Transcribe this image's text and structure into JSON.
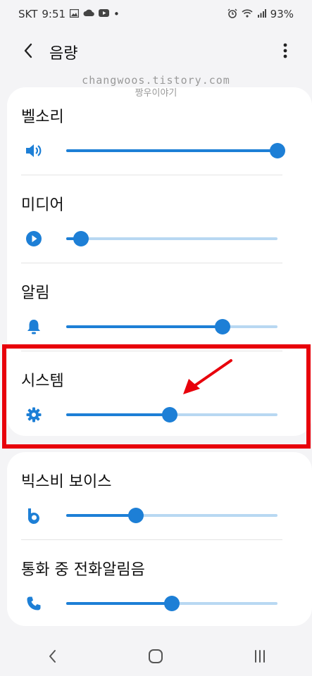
{
  "status_bar": {
    "carrier": "SKT",
    "time": "9:51",
    "dot": "•",
    "battery": "93%",
    "left_icons": [
      "image-icon",
      "cloud-icon",
      "youtube-icon"
    ],
    "right_icons": [
      "alarm-icon",
      "wifi-icon",
      "signal-icon"
    ]
  },
  "header": {
    "title": "음량"
  },
  "watermark": {
    "line1": "changwoos.tistory.com",
    "line2": "짱우이야기"
  },
  "volume_rows": [
    {
      "label": "벨소리",
      "icon": "speaker-icon",
      "level": 1.0
    },
    {
      "label": "미디어",
      "icon": "play-icon",
      "level": 0.07
    },
    {
      "label": "알림",
      "icon": "bell-icon",
      "level": 0.74
    },
    {
      "label": "시스템",
      "icon": "gear-icon",
      "level": 0.49
    }
  ],
  "volume_rows_2": [
    {
      "label": "빅스비 보이스",
      "icon": "bixby-icon",
      "level": 0.33
    },
    {
      "label": "통화 중 전화알림음",
      "icon": "phone-icon",
      "level": 0.5
    }
  ],
  "colors": {
    "accent": "#1d7fd6",
    "track": "#b8d8f2",
    "highlight": "#e8000b"
  }
}
